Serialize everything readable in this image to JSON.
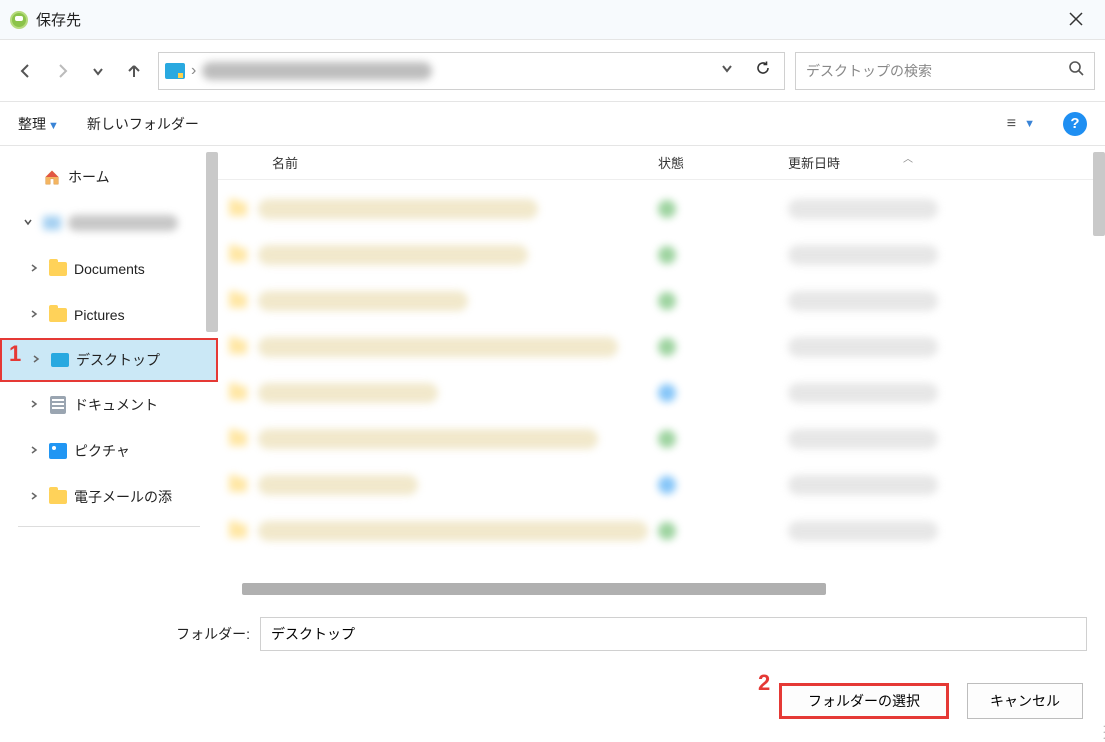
{
  "window": {
    "title": "保存先"
  },
  "nav": {
    "path_sep": "›"
  },
  "search": {
    "placeholder": "デスクトップの検索"
  },
  "toolbar": {
    "organize": "整理",
    "newfolder": "新しいフォルダー"
  },
  "sidebar": {
    "home": "ホーム",
    "documents": "Documents",
    "pictures": "Pictures",
    "desktop": "デスクトップ",
    "docs_jp": "ドキュメント",
    "pics_jp": "ピクチャ",
    "email": "電子メールの添"
  },
  "columns": {
    "name": "名前",
    "state": "状態",
    "date": "更新日時"
  },
  "rows": [
    {
      "nameW": 280,
      "state": "#4caf50",
      "dateW": 150
    },
    {
      "nameW": 270,
      "state": "#4caf50",
      "dateW": 150
    },
    {
      "nameW": 210,
      "state": "#4caf50",
      "dateW": 150
    },
    {
      "nameW": 360,
      "state": "#4caf50",
      "dateW": 150
    },
    {
      "nameW": 180,
      "state": "#2196f3",
      "dateW": 150
    },
    {
      "nameW": 340,
      "state": "#4caf50",
      "dateW": 150
    },
    {
      "nameW": 160,
      "state": "#2196f3",
      "dateW": 150
    },
    {
      "nameW": 390,
      "state": "#4caf50",
      "dateW": 150
    }
  ],
  "footer": {
    "folder_label": "フォルダー:",
    "folder_value": "デスクトップ",
    "select": "フォルダーの選択",
    "cancel": "キャンセル"
  },
  "annotations": {
    "one": "1",
    "two": "2"
  }
}
